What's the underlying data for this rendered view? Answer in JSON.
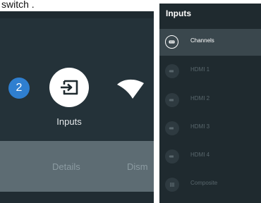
{
  "caption": "switch .",
  "home_screen": {
    "badge_number": "2",
    "inputs_label": "Inputs",
    "actions": {
      "details_label": "Details",
      "dismiss_label": "Dism"
    }
  },
  "inputs_panel": {
    "title": "Inputs",
    "items": [
      {
        "label": "Channels",
        "icon": "channels-icon",
        "selected": true
      },
      {
        "label": "HDMI 1",
        "icon": "hdmi-icon",
        "selected": false
      },
      {
        "label": "HDMI 2",
        "icon": "hdmi-icon",
        "selected": false
      },
      {
        "label": "HDMI 3",
        "icon": "hdmi-icon",
        "selected": false
      },
      {
        "label": "HDMI 4",
        "icon": "hdmi-icon",
        "selected": false
      },
      {
        "label": "Composite",
        "icon": "composite-icon",
        "selected": false
      }
    ]
  },
  "colors": {
    "home_background": "#243239",
    "badge_blue": "#2f7fd0",
    "panel_background": "#1f2a2f",
    "selected_row": "#3a474d"
  }
}
